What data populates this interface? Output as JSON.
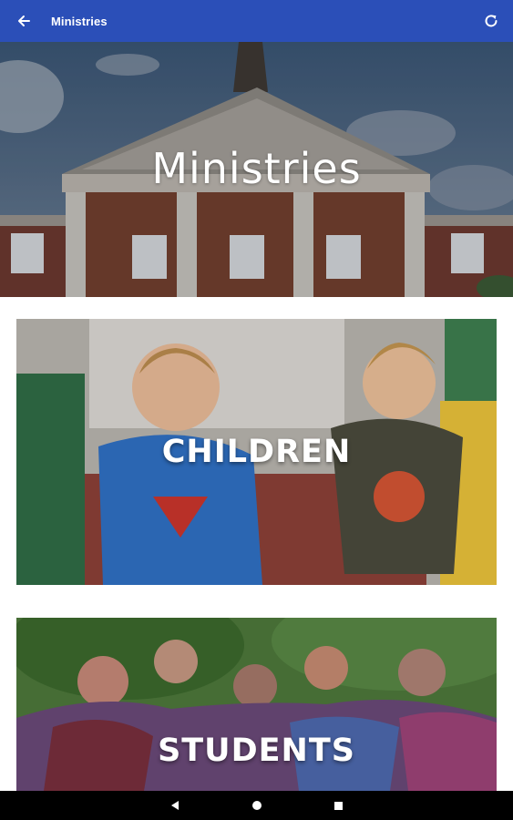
{
  "appbar": {
    "title": "Ministries",
    "back_icon": "arrow-left-icon",
    "refresh_icon": "refresh-icon",
    "background": "#2b4fb8"
  },
  "hero": {
    "title": "Ministries"
  },
  "ministries": [
    {
      "label": "CHILDREN"
    },
    {
      "label": "STUDENTS"
    }
  ],
  "navbar": {
    "icons": [
      "back-triangle-icon",
      "home-circle-icon",
      "recents-square-icon"
    ]
  }
}
